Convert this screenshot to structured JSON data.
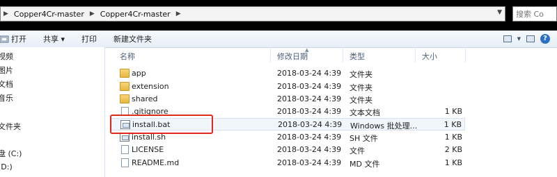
{
  "address": {
    "crumbs": [
      "Copper4Cr-master",
      "Copper4Cr-master"
    ],
    "search_placeholder": "搜索 Co"
  },
  "toolbar": {
    "open": "打开",
    "share": "共享 ▾",
    "print": "打印",
    "new_folder": "新建文件夹"
  },
  "nav": {
    "items": [
      "视频",
      "图片",
      "文档",
      "音乐",
      "文件夹",
      "盘 (C:)",
      "(D:)"
    ]
  },
  "columns": {
    "name": "名称",
    "date": "修改日期",
    "type": "类型",
    "size": "大小"
  },
  "files": [
    {
      "name": "app",
      "date": "2018-03-24 4:39",
      "type": "文件夹",
      "size": "",
      "icon": "folder-icon"
    },
    {
      "name": "extension",
      "date": "2018-03-24 4:39",
      "type": "文件夹",
      "size": "",
      "icon": "folder-icon"
    },
    {
      "name": "shared",
      "date": "2018-03-24 4:39",
      "type": "文件夹",
      "size": "",
      "icon": "folder-icon"
    },
    {
      "name": ".gitignore",
      "date": "2018-03-24 4:39",
      "type": "文本文档",
      "size": "1 KB",
      "icon": "text-file-icon"
    },
    {
      "name": "install.bat",
      "date": "2018-03-24 4:39",
      "type": "Windows 批处理...",
      "size": "1 KB",
      "icon": "batch-file-icon"
    },
    {
      "name": "install.sh",
      "date": "2018-03-24 4:39",
      "type": "SH 文件",
      "size": "1 KB",
      "icon": "script-file-icon"
    },
    {
      "name": "LICENSE",
      "date": "2018-03-24 4:39",
      "type": "文件",
      "size": "2 KB",
      "icon": "file-icon"
    },
    {
      "name": "README.md",
      "date": "2018-03-24 4:39",
      "type": "MD 文件",
      "size": "1 KB",
      "icon": "file-icon"
    }
  ],
  "colors": {
    "highlight": "#e0281c",
    "folder": "#e8b73e"
  }
}
